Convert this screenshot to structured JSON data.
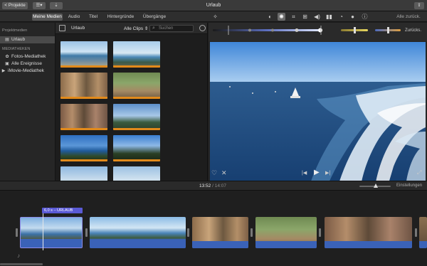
{
  "titlebar": {
    "back_button": "< Projekte",
    "title": "Urlaub",
    "library_icon": "library-list-icon",
    "download_icon": "download-icon",
    "share_icon": "share-icon"
  },
  "tabs": [
    {
      "label": "Meine Medien",
      "active": true
    },
    {
      "label": "Audio",
      "active": false
    },
    {
      "label": "Titel",
      "active": false
    },
    {
      "label": "Hintergründe",
      "active": false
    },
    {
      "label": "Übergänge",
      "active": false
    }
  ],
  "toolbar": {
    "reset_all": "Alle zurück.",
    "reset": "Zurücks."
  },
  "sidebar": {
    "section1": "Projektmedien",
    "project_item": "Urlaub",
    "section2": "MEDIATHEKEN",
    "items": [
      {
        "label": "Fotos-Mediathek",
        "icon": "photos-icon"
      },
      {
        "label": "Alle Ereignisse",
        "icon": "events-icon"
      },
      {
        "label": "iMovie-Mediathek",
        "icon": "disclosure-triangle-icon"
      }
    ]
  },
  "browser": {
    "title": "Urlaub",
    "filter": "Alle Clips",
    "search_placeholder": "Suchen"
  },
  "timeline": {
    "current_time": "13:52",
    "separator": "/",
    "total_time": "14:07",
    "settings": "Einstellungen",
    "clip_label": "6,0 s – URLAUB"
  },
  "colors": {
    "accent_orange": "#e28a1b",
    "audio_blue": "#3a62b8",
    "selection_purple": "#5a5ad6"
  }
}
